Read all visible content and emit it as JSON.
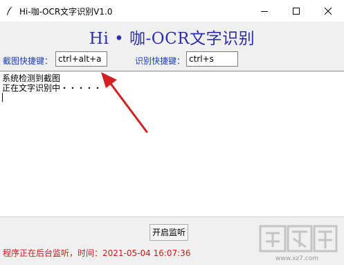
{
  "window": {
    "title": "Hi-咖-OCR文字识别V1.0"
  },
  "app": {
    "heading": "Hi • 咖-OCR文字识别",
    "screenshot_hotkey_label": "截图快捷键：",
    "screenshot_hotkey_value": "ctrl+alt+a",
    "recognize_hotkey_label": "识别快捷键：",
    "recognize_hotkey_value": "ctrl+s",
    "output_lines": [
      "系统检测到截图",
      "正在文字识别中・・・・・"
    ],
    "start_button": "开启监听",
    "status_text": "程序正在后台监听，时间：2021-05-04 16:07:36"
  },
  "watermark": {
    "url": "www.xz7.com"
  },
  "colors": {
    "heading": "#2c2cb4",
    "label": "#1a3fbf",
    "status": "#d21a1a",
    "arrow": "#d42020",
    "client_bg": "#f0f0f0"
  },
  "icons": [
    "feather-icon",
    "minimize-icon",
    "maximize-icon",
    "close-icon",
    "arrow-annotation"
  ]
}
